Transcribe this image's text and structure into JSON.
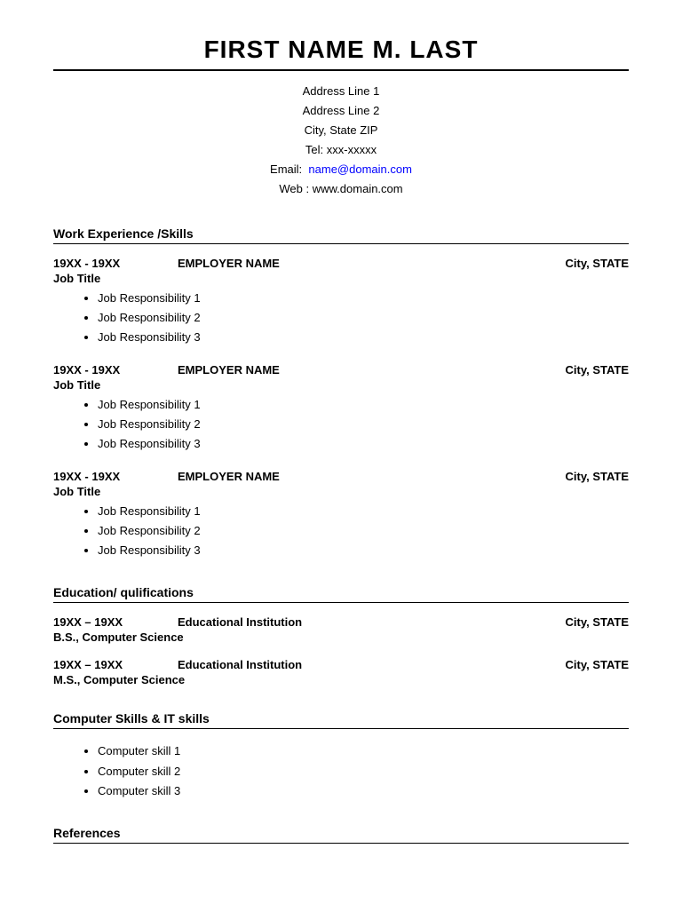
{
  "header": {
    "name": "FIRST NAME M. LAST",
    "address_line1": "Address Line 1",
    "address_line2": "Address Line 2",
    "city_state_zip": "City, State ZIP",
    "tel_label": "Tel:",
    "tel_value": "xxx-xxxxx",
    "email_label": "Email:",
    "email_value": "name@domain.com",
    "web_label": "Web :",
    "web_value": "www.domain.com"
  },
  "sections": {
    "work_experience": {
      "title": "Work Experience /Skills",
      "jobs": [
        {
          "dates": "19XX - 19XX",
          "employer": "EMPLOYER NAME",
          "location": "City, STATE",
          "title": "Job Title",
          "duties": [
            "Job Responsibility 1",
            "Job Responsibility 2",
            "Job Responsibility 3"
          ]
        },
        {
          "dates": "19XX - 19XX",
          "employer": "EMPLOYER NAME",
          "location": "City, STATE",
          "title": "Job Title",
          "duties": [
            "Job Responsibility 1",
            "Job Responsibility 2",
            "Job Responsibility 3"
          ]
        },
        {
          "dates": "19XX - 19XX",
          "employer": "EMPLOYER NAME",
          "location": "City, STATE",
          "title": "Job Title",
          "duties": [
            "Job Responsibility 1",
            "Job Responsibility 2",
            "Job Responsibility 3"
          ]
        }
      ]
    },
    "education": {
      "title": "Education/ qulifications",
      "entries": [
        {
          "dates": "19XX – 19XX",
          "institution": "Educational Institution",
          "location": "City, STATE",
          "degree": "B.S., Computer Science"
        },
        {
          "dates": "19XX – 19XX",
          "institution": "Educational Institution",
          "location": "City, STATE",
          "degree": "M.S., Computer Science"
        }
      ]
    },
    "computer_skills": {
      "title": "Computer Skills & IT skills",
      "skills": [
        "Computer skill 1",
        "Computer skill 2",
        "Computer skill 3"
      ]
    },
    "references": {
      "title": "References"
    }
  }
}
